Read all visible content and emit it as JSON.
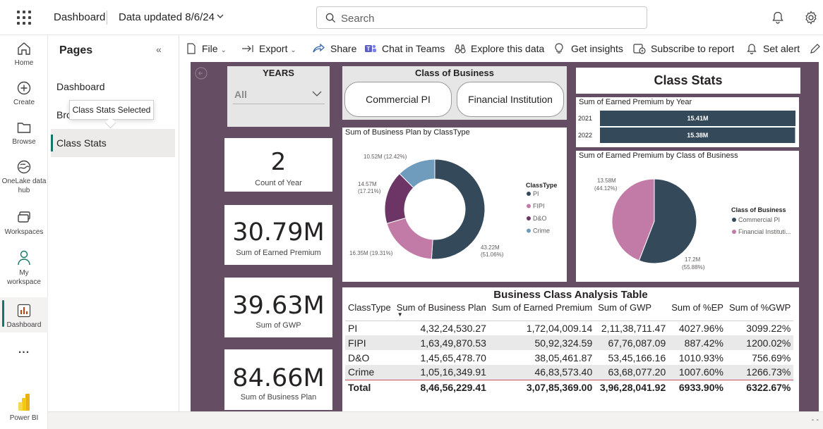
{
  "topbar": {
    "title": "Dashboard",
    "updated": "Data updated 8/6/24",
    "search_placeholder": "Search"
  },
  "leftnav": [
    {
      "label": "Home",
      "icon": "home-icon"
    },
    {
      "label": "Create",
      "icon": "plus-circle-icon"
    },
    {
      "label": "Browse",
      "icon": "folder-icon"
    },
    {
      "label": "OneLake data hub",
      "icon": "onelake-icon"
    },
    {
      "label": "Workspaces",
      "icon": "workspaces-icon"
    },
    {
      "label": "My workspace",
      "icon": "person-icon"
    },
    {
      "label": "Dashboard",
      "icon": "report-icon"
    },
    {
      "label": "...",
      "icon": "more-icon"
    },
    {
      "label": "Power BI",
      "icon": "powerbi-logo-icon"
    }
  ],
  "pages": {
    "title": "Pages",
    "items": [
      "Dashboard",
      "Bro",
      "Class Stats"
    ],
    "tooltip": "Class Stats Selected"
  },
  "actions": {
    "file": "File",
    "export": "Export",
    "share": "Share",
    "chat": "Chat in Teams",
    "explore": "Explore this data",
    "insights": "Get insights",
    "subscribe": "Subscribe to report",
    "alert": "Set alert"
  },
  "report": {
    "years_slicer": {
      "title": "YEARS",
      "value": "All"
    },
    "cards": [
      {
        "value": "2",
        "label": "Count of Year"
      },
      {
        "value": "30.79M",
        "label": "Sum of Earned Premium"
      },
      {
        "value": "39.63M",
        "label": "Sum of GWP"
      },
      {
        "value": "84.66M",
        "label": "Sum of Business Plan"
      }
    ],
    "class_of_business": {
      "title": "Class of Business",
      "buttons": [
        "Commercial PI",
        "Financial Institution"
      ]
    },
    "class_stats_title": "Class Stats",
    "colors": {
      "dark": "#34495a",
      "pink": "#c27ba6",
      "purple": "#6c3565",
      "blue": "#6f9bbd",
      "bg": "#654e64"
    }
  },
  "chart_data": [
    {
      "type": "pie",
      "subtype": "donut",
      "title": "Sum of Business Plan by ClassType",
      "legend_title": "ClassType",
      "legend_position": "right",
      "categories": [
        "PI",
        "FIPI",
        "D&O",
        "Crime"
      ],
      "values": [
        43.22,
        16.35,
        14.57,
        10.52
      ],
      "labels": [
        "43.22M (51.06%)",
        "16.35M (19.31%)",
        "14.57M (17.21%)",
        "10.52M (12.42%)"
      ],
      "colors": [
        "#34495a",
        "#c27ba6",
        "#6c3565",
        "#6f9bbd"
      ]
    },
    {
      "type": "bar",
      "orientation": "horizontal",
      "title": "Sum of Earned Premium by Year",
      "categories": [
        "2021",
        "2022"
      ],
      "values": [
        15.41,
        15.38
      ],
      "labels": [
        "15.41M",
        "15.38M"
      ],
      "color": "#34495a"
    },
    {
      "type": "pie",
      "title": "Sum of Earned Premium by Class of Business",
      "legend_title": "Class of Business",
      "legend_position": "right",
      "categories": [
        "Commercial PI",
        "Financial Instituti..."
      ],
      "values": [
        17.2,
        13.58
      ],
      "labels": [
        "17.2M (55.88%)",
        "13.58M (44.12%)"
      ],
      "colors": [
        "#34495a",
        "#c27ba6"
      ]
    },
    {
      "type": "table",
      "title": "Business Class Analysis Table",
      "columns": [
        "ClassType",
        "Sum of Business Plan",
        "Sum of Earned Premium",
        "Sum of GWP",
        "Sum of %EP",
        "Sum of %GWP"
      ],
      "rows": [
        [
          "PI",
          "4,32,24,530.27",
          "1,72,04,009.14",
          "2,11,38,711.47",
          "4027.96%",
          "3099.22%"
        ],
        [
          "FIPI",
          "1,63,49,870.53",
          "50,92,324.59",
          "67,76,087.09",
          "887.42%",
          "1200.02%"
        ],
        [
          "D&O",
          "1,45,65,478.70",
          "38,05,461.87",
          "53,45,166.16",
          "1010.93%",
          "756.69%"
        ],
        [
          "Crime",
          "1,05,16,349.91",
          "46,83,573.40",
          "63,68,077.20",
          "1007.60%",
          "1266.73%"
        ]
      ],
      "total": [
        "Total",
        "8,46,56,229.41",
        "3,07,85,369.00",
        "3,96,28,041.92",
        "6933.90%",
        "6322.67%"
      ]
    }
  ]
}
